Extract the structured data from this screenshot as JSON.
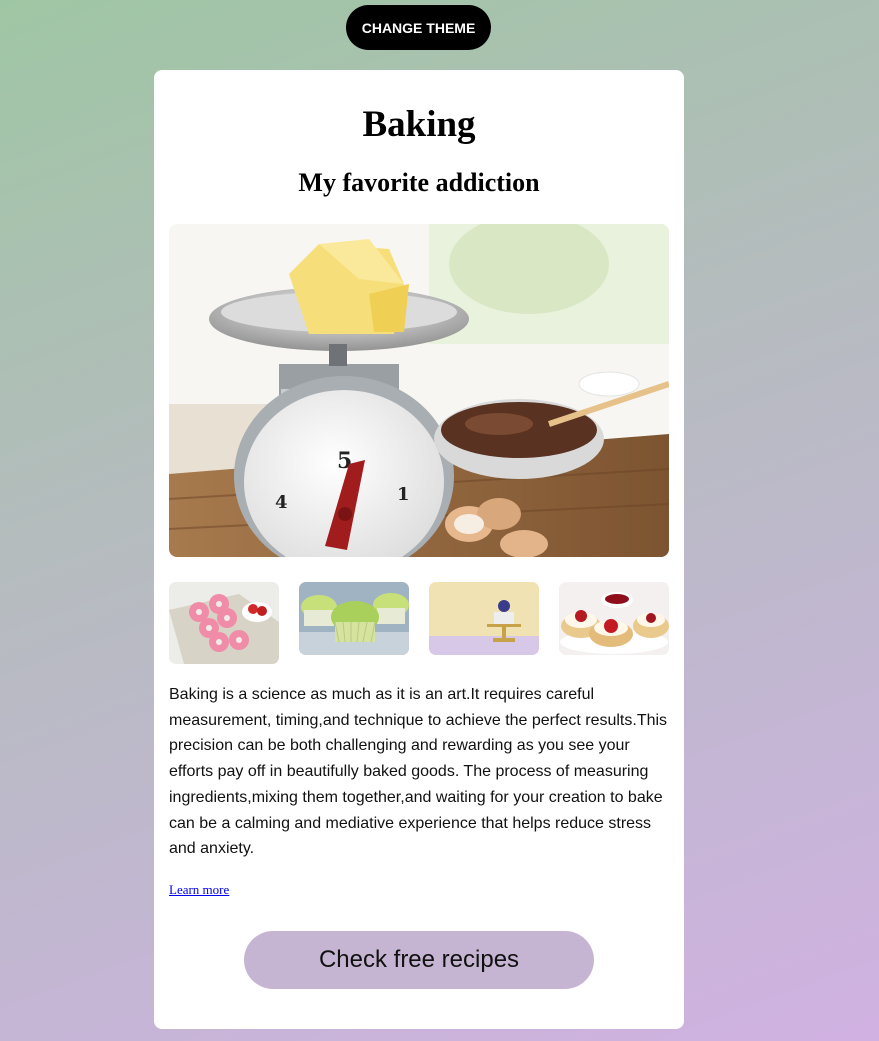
{
  "theme_button": {
    "label": "CHANGE THEME"
  },
  "card": {
    "title": "Baking",
    "subtitle": "My favorite addiction",
    "hero_image": {
      "subject": "kitchen scale with butter, bowl of cocoa and eggshells",
      "scale_number": "5"
    },
    "thumbnails": [
      {
        "subject": "pink sprinkled donuts"
      },
      {
        "subject": "green frosted cupcakes"
      },
      {
        "subject": "mini cake on gold stand"
      },
      {
        "subject": "scones with strawberry jam"
      }
    ],
    "description": "Baking is a science as much as it is an art.It requires careful measurement, timing,and technique to achieve the perfect results.This precision can be both challenging and rewarding as you see your efforts pay off in beautifully baked goods. The process of measuring ingredients,mixing them together,and waiting for your creation to bake can be a calming and mediative experience that helps reduce stress and anxiety.",
    "learn_more": "Learn more",
    "recipes_button": "Check free recipes"
  },
  "colors": {
    "background_start": "#9fc6a4",
    "background_end": "#d1b1e2",
    "card": "#ffffff",
    "theme_button": "#000000",
    "recipes_button": "#c6b5d2",
    "link": "#0000ee"
  }
}
